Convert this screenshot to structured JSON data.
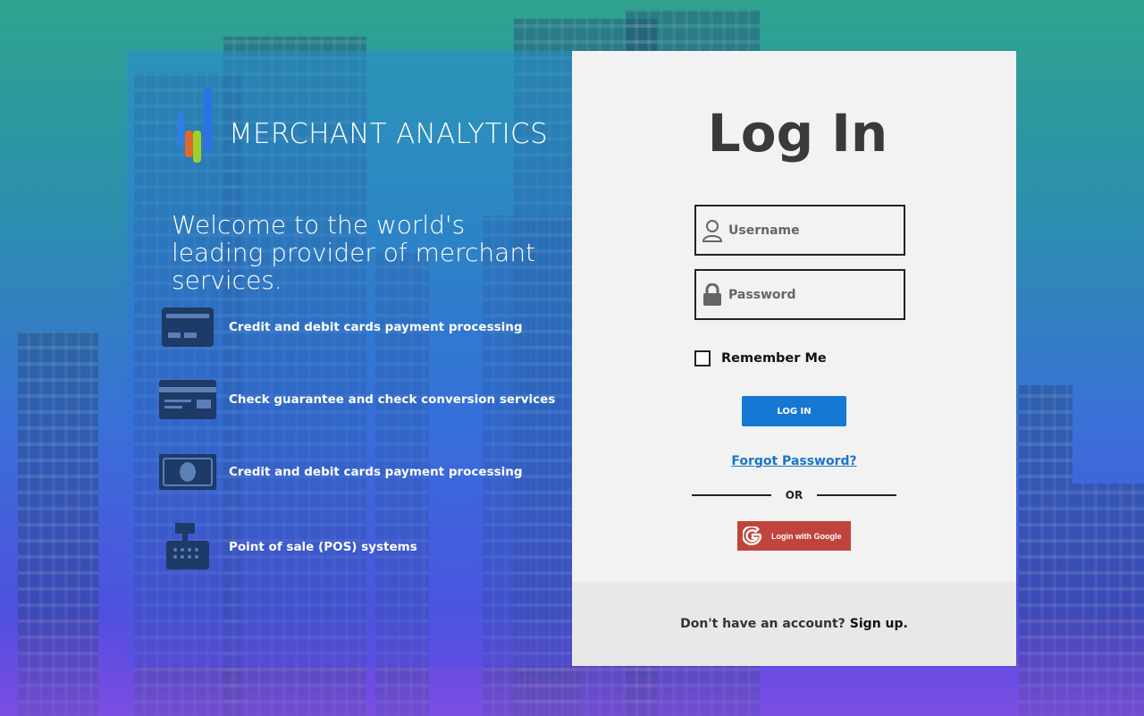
{
  "brand": {
    "name": "MERCHANT ANALYTICS"
  },
  "welcome": {
    "text": "Welcome to the world's leading provider of merchant services."
  },
  "features": [
    {
      "icon": "credit-card-icon",
      "label": "Credit and debit cards payment processing"
    },
    {
      "icon": "check-card-icon",
      "label": "Check guarantee and check conversion services"
    },
    {
      "icon": "cash-icon",
      "label": "Credit and debit cards payment processing"
    },
    {
      "icon": "cash-register-icon",
      "label": "Point of sale (POS) systems"
    }
  ],
  "login": {
    "title": "Log In",
    "username_placeholder": "Username",
    "password_placeholder": "Password",
    "remember_label": "Remember Me",
    "button_label": "LOG IN",
    "forgot_label": "Forgot Password?",
    "or_label": "OR",
    "google_label": "Login with Google"
  },
  "footer": {
    "prompt": "Don't have an account?",
    "signup_label": "Sign up."
  },
  "colors": {
    "primary": "#1578d2",
    "google": "#c0443c",
    "link": "#1a74c8"
  }
}
